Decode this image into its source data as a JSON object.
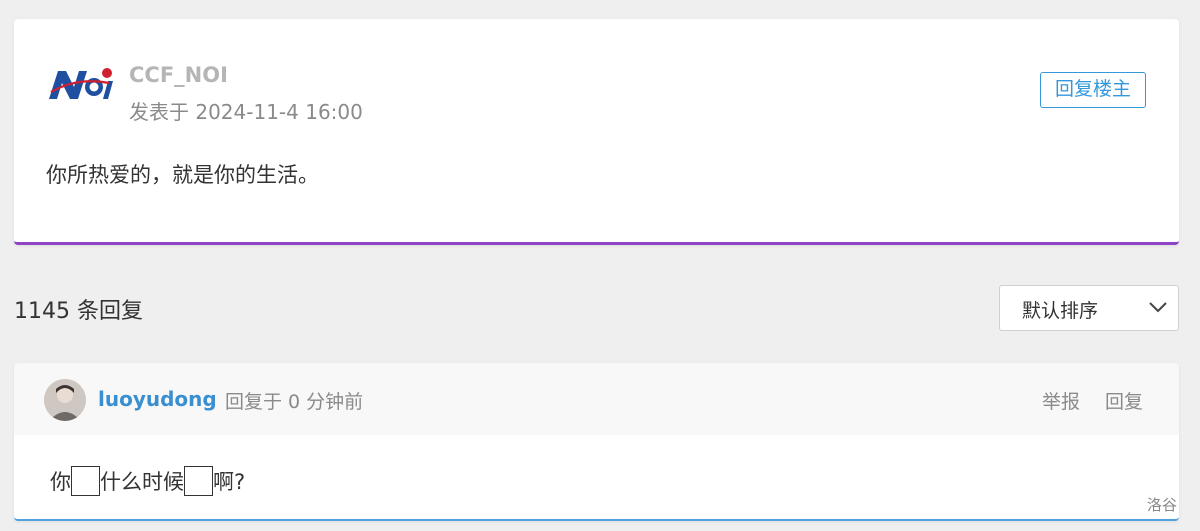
{
  "post": {
    "author": "CCF_NOI",
    "time": "发表于 2024-11-4 16:00",
    "reply_op_label": "回复楼主",
    "content": "你所热爱的，就是你的生活。",
    "logo_text": "NOI"
  },
  "replies_header": {
    "count_label": "1145 条回复",
    "sort_selected": "默认排序"
  },
  "reply": {
    "user": "luoyudong",
    "time": "回复于 0 分钟前",
    "report_label": "举报",
    "reply_label": "回复",
    "content_parts": [
      "你",
      "什么时候",
      "啊?"
    ]
  },
  "watermark": "洛谷",
  "colors": {
    "accent_purple": "#8e44c4",
    "accent_blue": "#3498db",
    "username_blue": "#3a8fd0",
    "logo_blue": "#1e4fa0",
    "logo_red": "#d0202f"
  }
}
